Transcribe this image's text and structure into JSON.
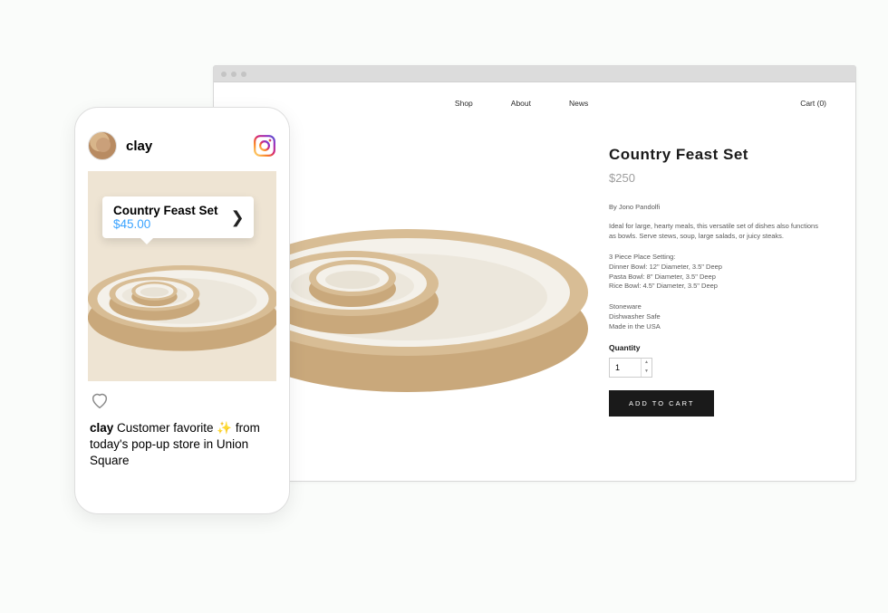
{
  "browser": {
    "nav": {
      "shop": "Shop",
      "about": "About",
      "news": "News",
      "cart": "Cart (0)"
    },
    "product": {
      "title": "Country Feast Set",
      "price": "$250",
      "by": "By Jono Pandolfi",
      "desc": "Ideal for large, hearty meals, this versatile set of dishes also functions as bowls. Serve stews, soup, large salads, or juicy steaks.",
      "specs": "3 Piece Place Setting:\nDinner Bowl: 12\" Diameter, 3.5\" Deep\nPasta Bowl: 8\" Diameter, 3.5\" Deep\nRice Bowl: 4.5\" Diameter, 3.5\" Deep",
      "materials": "Stoneware\nDishwasher Safe\nMade in the USA",
      "qty_label": "Quantity",
      "qty_value": "1",
      "add_cart": "ADD TO CART"
    }
  },
  "phone": {
    "user": "clay",
    "bubble": {
      "title": "Country Feast Set",
      "price": "$45.00"
    },
    "caption_user": "clay",
    "caption_text": " Customer favorite ",
    "caption_text2": " from today's pop-up store in Union Square"
  }
}
